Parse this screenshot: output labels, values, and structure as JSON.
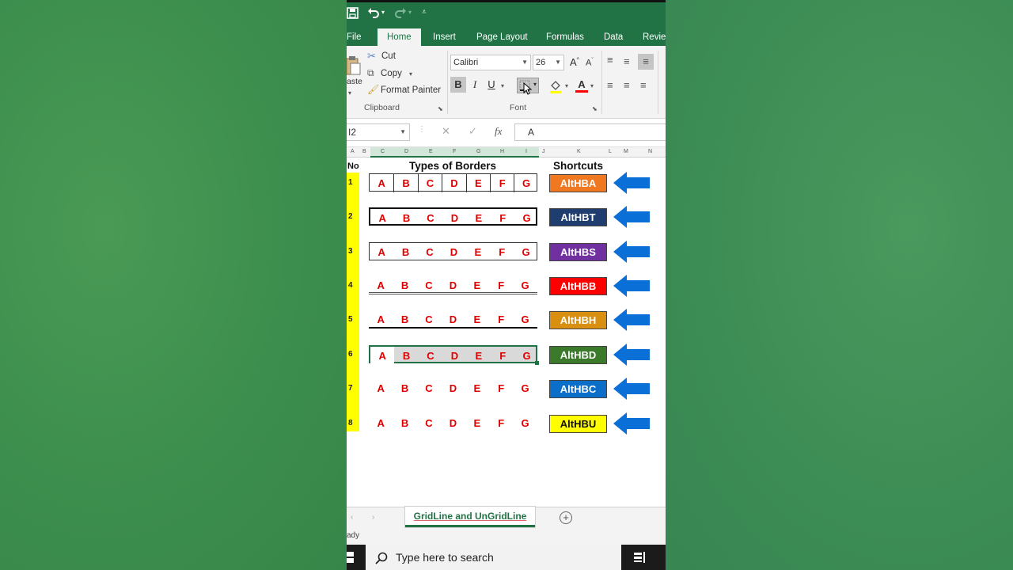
{
  "title_bar": {
    "quick_access": [
      "save-icon",
      "undo-icon",
      "redo-icon",
      "customize-icon"
    ]
  },
  "ribbon_tabs": [
    "File",
    "Home",
    "Insert",
    "Page Layout",
    "Formulas",
    "Data",
    "Revie"
  ],
  "active_tab": "Home",
  "clipboard": {
    "paste_label": "aste",
    "cut": "Cut",
    "copy": "Copy",
    "format_painter": "Format Painter",
    "group_label": "Clipboard"
  },
  "font": {
    "font_name": "Calibri",
    "font_size": "26",
    "bold": "B",
    "italic": "I",
    "underline": "U",
    "group_label": "Font"
  },
  "formula_bar": {
    "name_box": "I2",
    "fx": "fx",
    "content": "A"
  },
  "column_headers": [
    "A",
    "B",
    "C",
    "D",
    "E",
    "F",
    "G",
    "H",
    "I",
    "J",
    "K",
    "L",
    "M",
    "N"
  ],
  "sheet": {
    "no_header": "No",
    "types_header": "Types of Borders",
    "shortcuts_header": "Shortcuts",
    "letters": [
      "A",
      "B",
      "C",
      "D",
      "E",
      "F",
      "G"
    ],
    "rows": [
      {
        "no": "1",
        "shortcut": "AltHBA",
        "bg": "#f07820",
        "fg": "#ffffff"
      },
      {
        "no": "2",
        "shortcut": "AltHBT",
        "bg": "#1f3d6e",
        "fg": "#ffffff"
      },
      {
        "no": "3",
        "shortcut": "AltHBS",
        "bg": "#7030a0",
        "fg": "#ffffff"
      },
      {
        "no": "4",
        "shortcut": "AltHBB",
        "bg": "#ff0000",
        "fg": "#ffffff"
      },
      {
        "no": "5",
        "shortcut": "AltHBH",
        "bg": "#d99010",
        "fg": "#ffffff"
      },
      {
        "no": "6",
        "shortcut": "AltHBD",
        "bg": "#3a7a2a",
        "fg": "#ffffff"
      },
      {
        "no": "7",
        "shortcut": "AltHBC",
        "bg": "#0b6fc9",
        "fg": "#ffffff"
      },
      {
        "no": "8",
        "shortcut": "AltHBU",
        "bg": "#ffff00",
        "fg": "#111111"
      }
    ]
  },
  "sheet_tab": "GridLine and UnGridLine",
  "status": "ady",
  "taskbar": {
    "search_placeholder": "Type here to search"
  },
  "colors": {
    "excel_green": "#217346",
    "letter_red": "#e00000",
    "arrow_blue": "#0a6fd6",
    "row_highlight": "#ffff00"
  }
}
